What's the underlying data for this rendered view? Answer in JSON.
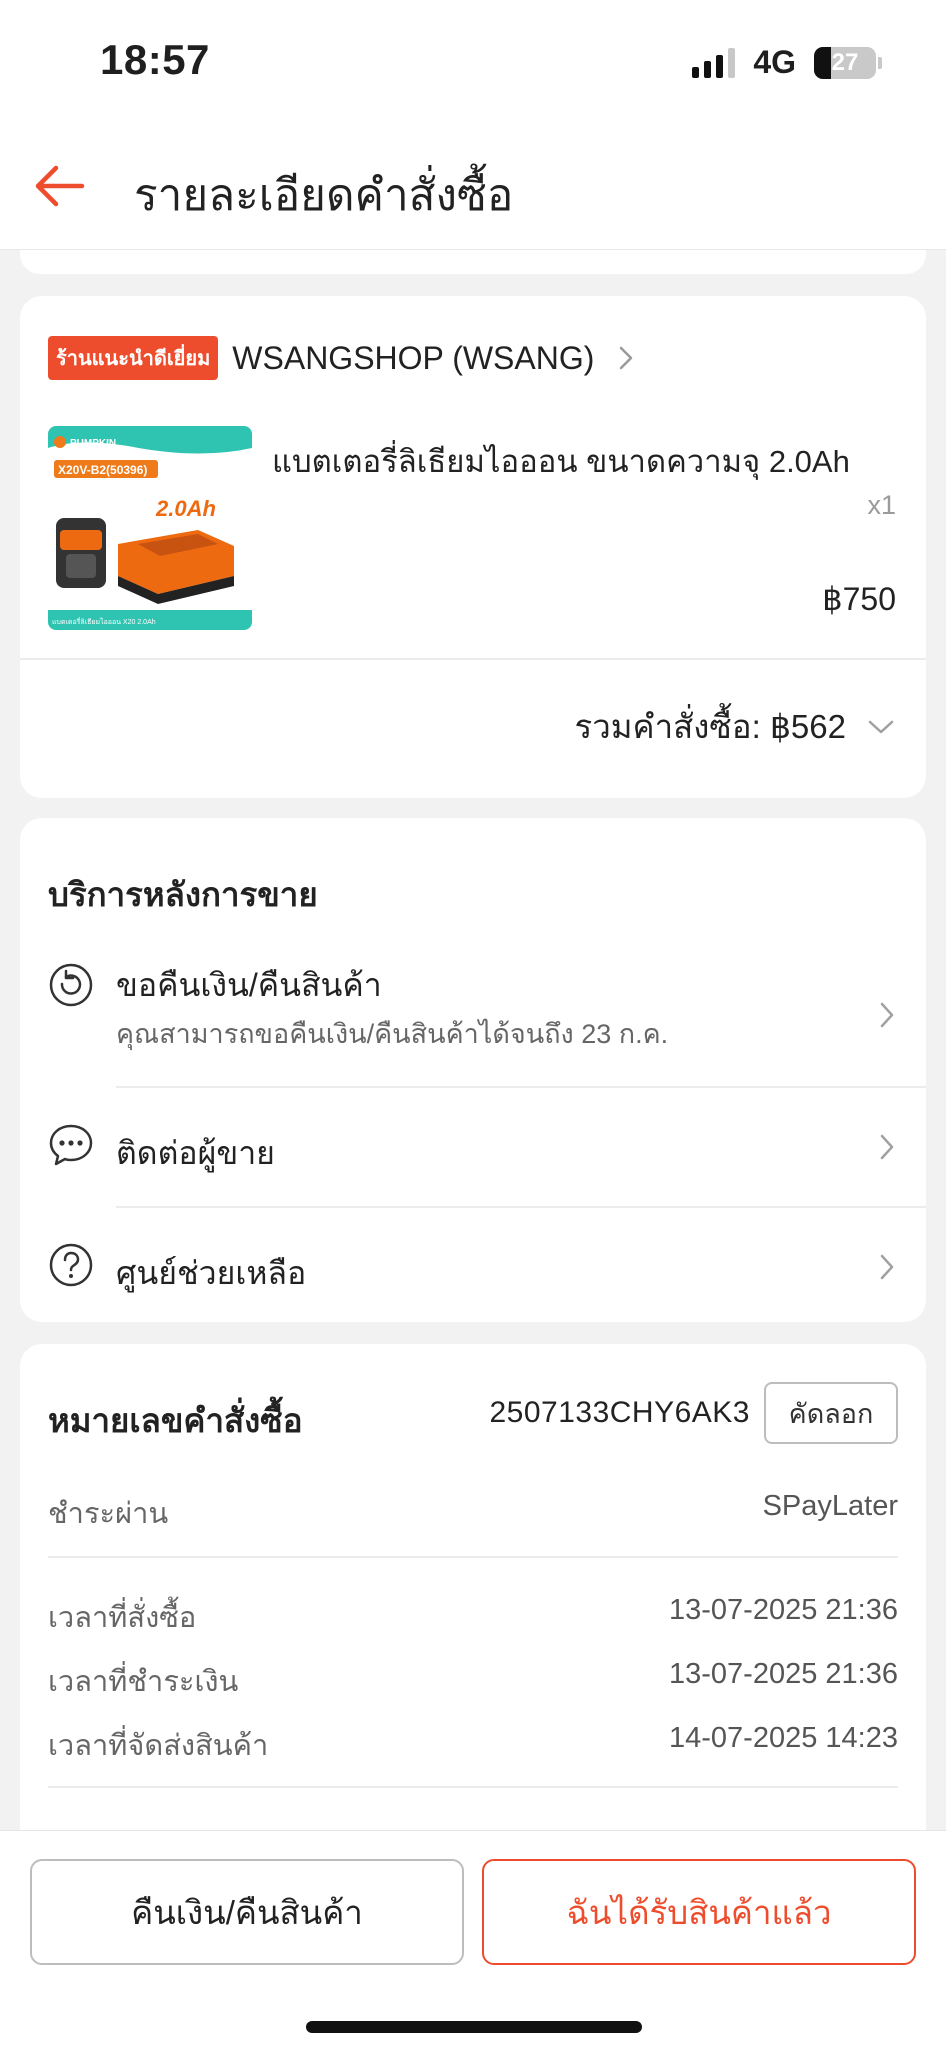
{
  "status_bar": {
    "time": "18:57",
    "network": "4G",
    "battery": "27",
    "battery_level": 0.27
  },
  "header": {
    "title": "รายละเอียดคำสั่งซื้อ"
  },
  "shop": {
    "badge": "ร้านแนะนำดีเยี่ยม",
    "name": "WSANGSHOP (WSANG)",
    "product": {
      "name": "แบตเตอรี่ลิเธียมไอออน ขนาดความจุ 2.0Ah",
      "qty": "x1",
      "price": "฿750",
      "image_brand": "PUMPKIN",
      "image_model": "X20V-B2(50396)",
      "image_capacity": "2.0Ah",
      "image_caption": "แบตเตอรี่ลิเธียมไอออน X20 2.0Ah"
    },
    "total": "รวมคำสั่งซื้อ: ฿562"
  },
  "after_sales": {
    "title": "บริการหลังการขาย",
    "items": [
      {
        "label": "ขอคืนเงิน/คืนสินค้า",
        "sub": "คุณสามารถขอคืนเงิน/คืนสินค้าได้จนถึง 23 ก.ค.",
        "icon": "return-icon"
      },
      {
        "label": "ติดต่อผู้ขาย",
        "icon": "chat-icon"
      },
      {
        "label": "ศูนย์ช่วยเหลือ",
        "icon": "help-icon"
      }
    ]
  },
  "order": {
    "id_label": "หมายเลขคำสั่งซื้อ",
    "id": "2507133CHY6AK3",
    "copy_label": "คัดลอก",
    "payment_label": "ชำระผ่าน",
    "payment_value": "SPayLater",
    "times": [
      {
        "label": "เวลาที่สั่งซื้อ",
        "value": "13-07-2025 21:36"
      },
      {
        "label": "เวลาที่ชำระเงิน",
        "value": "13-07-2025 21:36"
      },
      {
        "label": "เวลาที่จัดส่งสินค้า",
        "value": "14-07-2025 14:23"
      }
    ]
  },
  "actions": {
    "return_label": "คืนเงิน/คืนสินค้า",
    "received_label": "ฉันได้รับสินค้าแล้ว"
  },
  "colors": {
    "accent": "#ee4d2d"
  }
}
